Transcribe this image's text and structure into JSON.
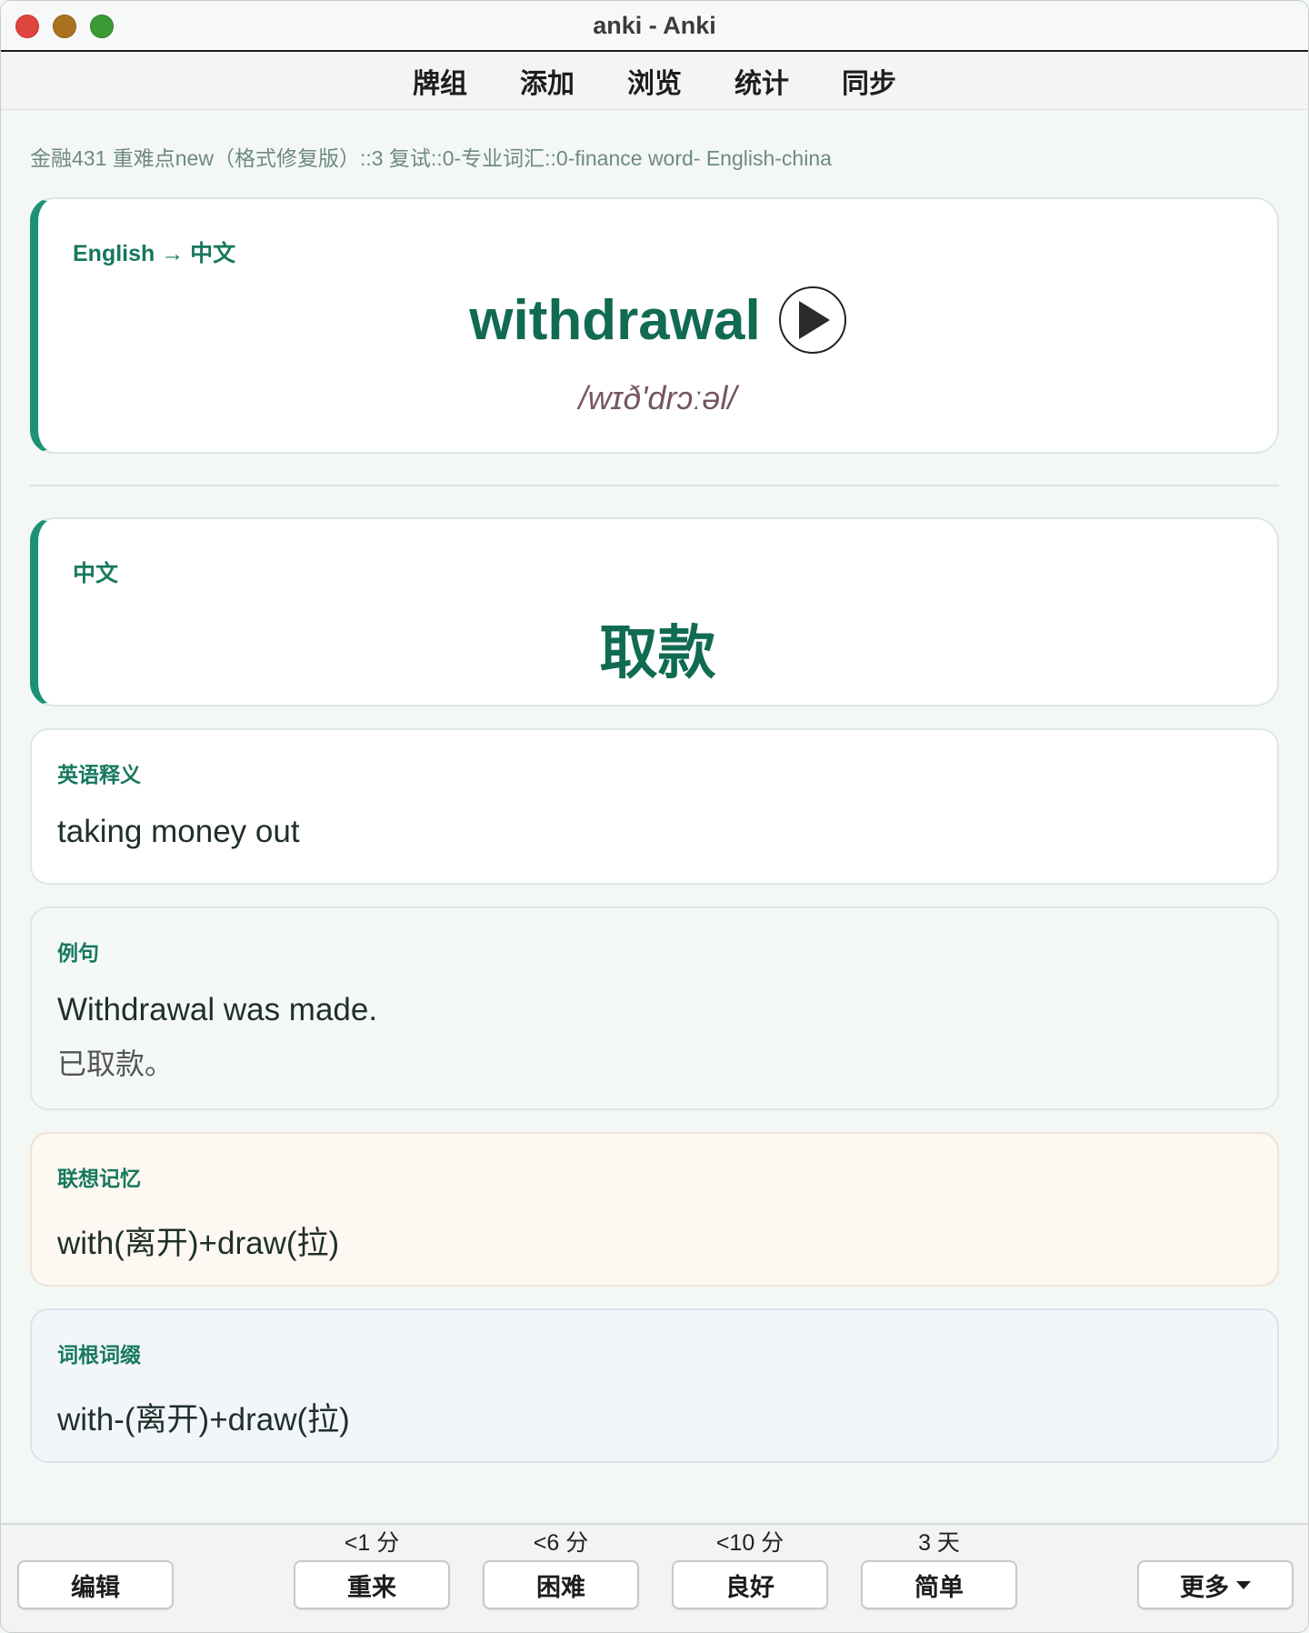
{
  "window": {
    "title": "anki - Anki"
  },
  "toolbar": {
    "items": [
      "牌组",
      "添加",
      "浏览",
      "统计",
      "同步"
    ]
  },
  "deck_path": "金融431 重难点new（格式修复版）::3 复试::0-专业词汇::0-finance word- English-china",
  "front": {
    "direction_label": "English → 中文",
    "word": "withdrawal",
    "phonetic": "/wɪð'drɔːəl/"
  },
  "meaning": {
    "label": "中文",
    "text": "取款"
  },
  "definition": {
    "label": "英语释义",
    "text": "taking money out"
  },
  "example": {
    "label": "例句",
    "sentence": "Withdrawal was made.",
    "translation": "已取款。"
  },
  "memory": {
    "label": "联想记忆",
    "text": "with(离开)+draw(拉)"
  },
  "roots": {
    "label": "词根词缀",
    "text": "with-(离开)+draw(拉)"
  },
  "bottom": {
    "edit": "编辑",
    "more": "更多",
    "answers": [
      {
        "interval": "<1 分",
        "label": "重来"
      },
      {
        "interval": "<6 分",
        "label": "困难"
      },
      {
        "interval": "<10 分",
        "label": "良好"
      },
      {
        "interval": "3 天",
        "label": "简单"
      }
    ]
  },
  "colors": {
    "accent": "#1a9273",
    "word": "#116b52",
    "phonetic": "#76565f"
  }
}
